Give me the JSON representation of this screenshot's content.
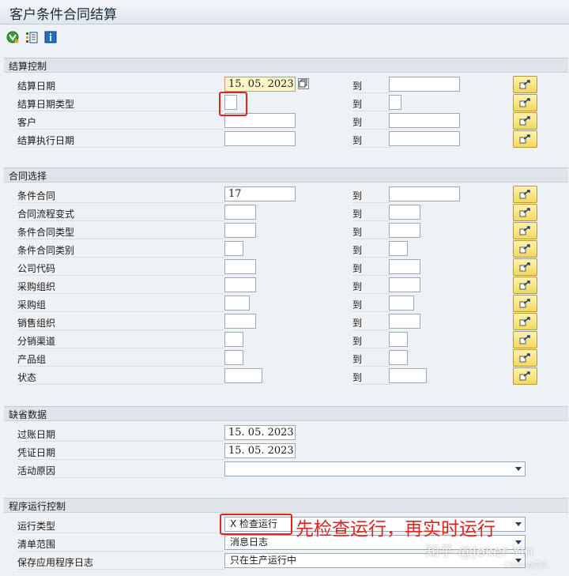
{
  "window": {
    "title": "客户条件合同结算"
  },
  "toolbar": {
    "icons": [
      "execute-icon",
      "selection-options-icon",
      "info-icon"
    ]
  },
  "sections": {
    "settlement": {
      "title": "结算控制",
      "rows": [
        {
          "label": "结算日期",
          "to": "到",
          "from_value": "15. 05. 2023",
          "to_value": ""
        },
        {
          "label": "结算日期类型",
          "to": "到",
          "from_value": "",
          "to_value": ""
        },
        {
          "label": "客户",
          "to": "到",
          "from_value": "",
          "to_value": ""
        },
        {
          "label": "结算执行日期",
          "to": "到",
          "from_value": "",
          "to_value": ""
        }
      ]
    },
    "contract": {
      "title": "合同选择",
      "rows": [
        {
          "label": "条件合同",
          "to": "到",
          "from_value": "17",
          "to_value": ""
        },
        {
          "label": "合同流程变式",
          "to": "到",
          "from_value": "",
          "to_value": ""
        },
        {
          "label": "条件合同类型",
          "to": "到",
          "from_value": "",
          "to_value": ""
        },
        {
          "label": "条件合同类别",
          "to": "到",
          "from_value": "",
          "to_value": ""
        },
        {
          "label": "公司代码",
          "to": "到",
          "from_value": "",
          "to_value": ""
        },
        {
          "label": "采购组织",
          "to": "到",
          "from_value": "",
          "to_value": ""
        },
        {
          "label": "采购组",
          "to": "到",
          "from_value": "",
          "to_value": ""
        },
        {
          "label": "销售组织",
          "to": "到",
          "from_value": "",
          "to_value": ""
        },
        {
          "label": "分销渠道",
          "to": "到",
          "from_value": "",
          "to_value": ""
        },
        {
          "label": "产品组",
          "to": "到",
          "from_value": "",
          "to_value": ""
        },
        {
          "label": "状态",
          "to": "到",
          "from_value": "",
          "to_value": ""
        }
      ]
    },
    "defaults": {
      "title": "缺省数据",
      "rows": [
        {
          "label": "过账日期",
          "value": "15. 05. 2023"
        },
        {
          "label": "凭证日期",
          "value": "15. 05. 2023"
        },
        {
          "label": "活动原因",
          "value": ""
        }
      ]
    },
    "run_control": {
      "title": "程序运行控制",
      "rows": [
        {
          "label": "运行类型",
          "value": "X 检查运行"
        },
        {
          "label": "清单范围",
          "value": "消息日志"
        },
        {
          "label": "保存应用程序日志",
          "value": "只在生产运行中"
        }
      ]
    }
  },
  "annotation": {
    "text": "先检查运行，再实时运行"
  },
  "watermark": {
    "text": "知乎 @Joker Yin",
    "sub": "CSDN @艾比"
  }
}
